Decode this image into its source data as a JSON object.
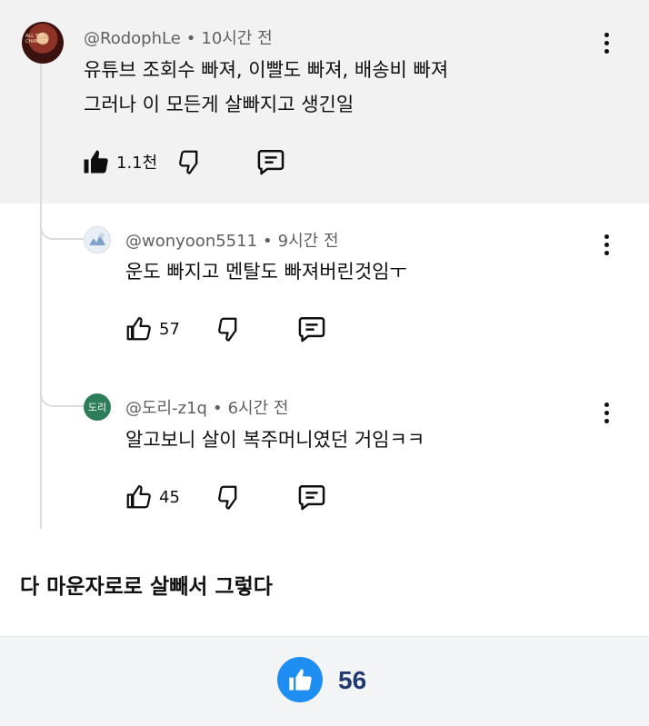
{
  "main_comment": {
    "author": "@RodophLe",
    "time": "10시간 전",
    "lines": [
      "유튜브 조회수 빠져, 이빨도 빠져, 배송비 빠져",
      "그러나 이 모든게 살빠지고 생긴일"
    ],
    "likes": "1.1천",
    "avatar_tag": "ALL THE CHANGES"
  },
  "replies": [
    {
      "author": "@wonyoon5511",
      "time": "9시간 전",
      "text": "운도 빠지고 멘탈도 빠져버린것임ㅜ",
      "likes": "57"
    },
    {
      "author": "@도리-z1q",
      "time": "6시간 전",
      "text": "알고보니 살이 복주머니였던 거임ㅋㅋ",
      "likes": "45",
      "avatar_label": "도리"
    }
  ],
  "post_caption": "다 마운자로로 살빼서 그렇다",
  "footer": {
    "like_count": "56"
  },
  "colors": {
    "accent": "#1e8ef2",
    "main_bg": "#f2f2f2",
    "meta": "#606060",
    "like_count": "#1e3a6e"
  }
}
